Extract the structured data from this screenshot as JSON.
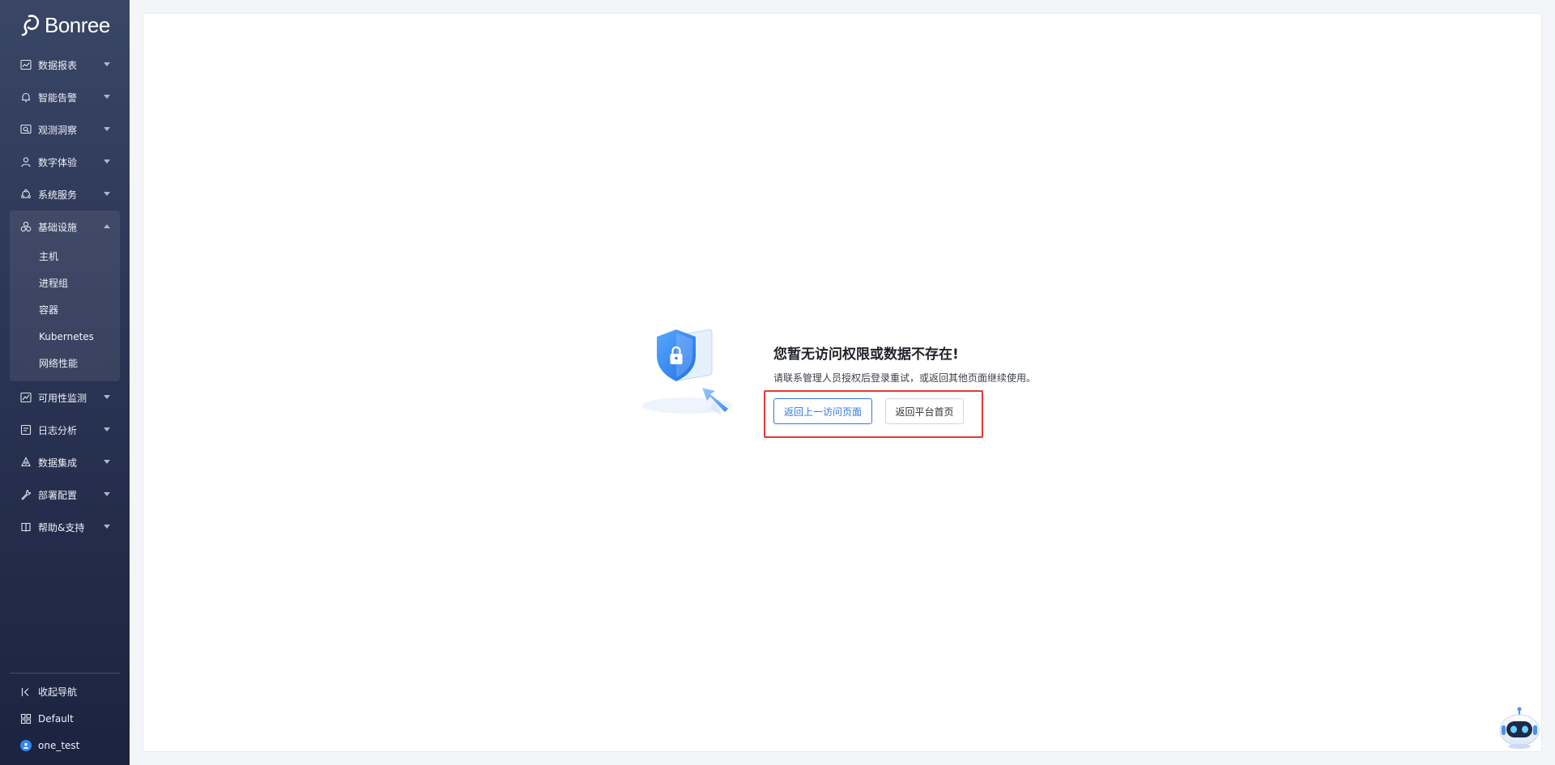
{
  "app": {
    "logo_text": "Bonree"
  },
  "sidebar": {
    "items": [
      {
        "label": "数据报表",
        "icon": "chart-line-icon"
      },
      {
        "label": "智能告警",
        "icon": "alarm-bell-icon"
      },
      {
        "label": "观测洞察",
        "icon": "search-monitor-icon"
      },
      {
        "label": "数字体验",
        "icon": "user-icon"
      },
      {
        "label": "系统服务",
        "icon": "service-nodes-icon"
      },
      {
        "label": "基础设施",
        "icon": "infrastructure-icon",
        "expanded": true,
        "children": [
          "主机",
          "进程组",
          "容器",
          "Kubernetes",
          "网络性能"
        ]
      },
      {
        "label": "可用性监测",
        "icon": "availability-chart-icon"
      },
      {
        "label": "日志分析",
        "icon": "log-icon"
      },
      {
        "label": "数据集成",
        "icon": "data-integration-icon"
      },
      {
        "label": "部署配置",
        "icon": "wrench-icon"
      },
      {
        "label": "帮助&支持",
        "icon": "book-icon"
      }
    ],
    "bottom": {
      "collapse_label": "收起导航",
      "workspace_label": "Default",
      "user_label": "one_test"
    }
  },
  "main": {
    "error_title": "您暂无访问权限或数据不存在!",
    "error_desc": "请联系管理人员授权后登录重试，或返回其他页面继续使用。",
    "back_button": "返回上一访问页面",
    "home_button": "返回平台首页"
  },
  "colors": {
    "sidebar_top": "#3a4666",
    "sidebar_bottom": "#1b2340",
    "primary": "#2f78e8",
    "highlight": "#e53935"
  }
}
